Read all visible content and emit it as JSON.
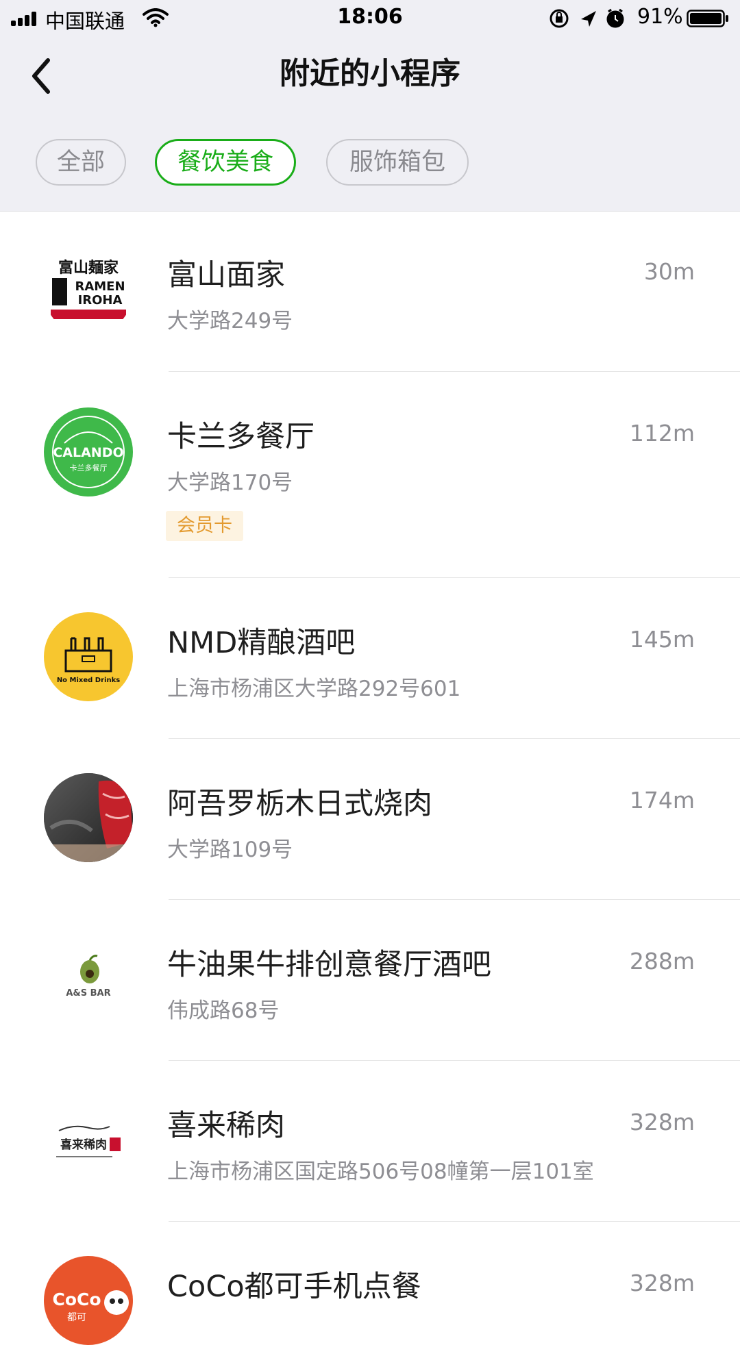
{
  "status_bar": {
    "carrier": "中国联通",
    "time": "18:06",
    "battery": "91%"
  },
  "nav": {
    "title": "附近的小程序",
    "back_icon": "chevron-left-icon"
  },
  "tabs": [
    {
      "label": "全部",
      "active": false
    },
    {
      "label": "餐饮美食",
      "active": true
    },
    {
      "label": "服饰箱包",
      "active": false
    }
  ],
  "colors": {
    "accent": "#1aad19",
    "badge_text": "#e39a2f",
    "badge_bg": "#fdf3e1",
    "header_bg": "#efeff4"
  },
  "items": [
    {
      "name": "富山面家",
      "address": "大学路249号",
      "distance": "30m",
      "logo_text": [
        "富山麺家",
        "RAMEN",
        "IROHA"
      ]
    },
    {
      "name": "卡兰多餐厅",
      "address": "大学路170号",
      "distance": "112m",
      "badge": "会员卡",
      "logo_text": [
        "CALANDO",
        "卡兰多餐厅"
      ]
    },
    {
      "name": "NMD精酿酒吧",
      "address": "上海市杨浦区大学路292号601",
      "distance": "145m",
      "logo_text": [
        "No Mixed Drinks"
      ]
    },
    {
      "name": "阿吾罗栃木日式烧肉",
      "address": "大学路109号",
      "distance": "174m"
    },
    {
      "name": "牛油果牛排创意餐厅酒吧",
      "address": "伟成路68号",
      "distance": "288m",
      "logo_text": [
        "A&S BAR"
      ]
    },
    {
      "name": "喜来稀肉",
      "address": "上海市杨浦区国定路506号08幢第一层101室",
      "distance": "328m",
      "logo_text": [
        "喜来稀肉"
      ]
    },
    {
      "name": "CoCo都可手机点餐",
      "address": "",
      "distance": "328m",
      "logo_text": [
        "CoCo",
        "都可"
      ]
    }
  ]
}
